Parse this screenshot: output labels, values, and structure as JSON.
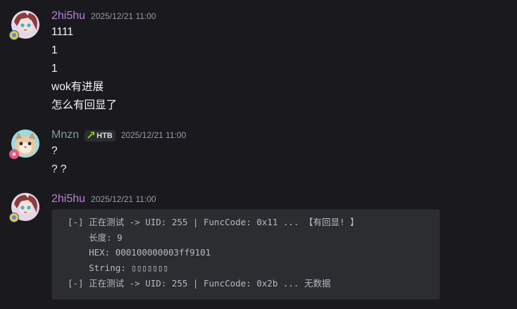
{
  "messages": [
    {
      "author": "2hi5hu",
      "timestamp": "2025/12/21 11:00",
      "lines": [
        "1111",
        "1",
        "1",
        "wok有进展",
        "怎么有回显了"
      ]
    },
    {
      "author": "Mnzn",
      "tag": "HTB",
      "timestamp": "2025/12/21 11:00",
      "lines": [
        "?",
        "? ?"
      ]
    },
    {
      "author": "2hi5hu",
      "timestamp": "2025/12/21 11:00",
      "code": [
        "[-] 正在测试 -> UID: 255 | FuncCode: 0x11 ... 【有回显! 】",
        "    长度: 9",
        "    HEX: 000100000003ff9101",
        "    String: ▯▯▯▯▯▯▯",
        "[-] 正在测试 -> UID: 255 | FuncCode: 0x2b ... 无数据"
      ]
    }
  ],
  "colors": {
    "background": "#1a1a1e",
    "author_2hi5hu": "#b583d6",
    "author_mnzn": "#7f9a9a",
    "code_bg": "#2b2d31"
  }
}
